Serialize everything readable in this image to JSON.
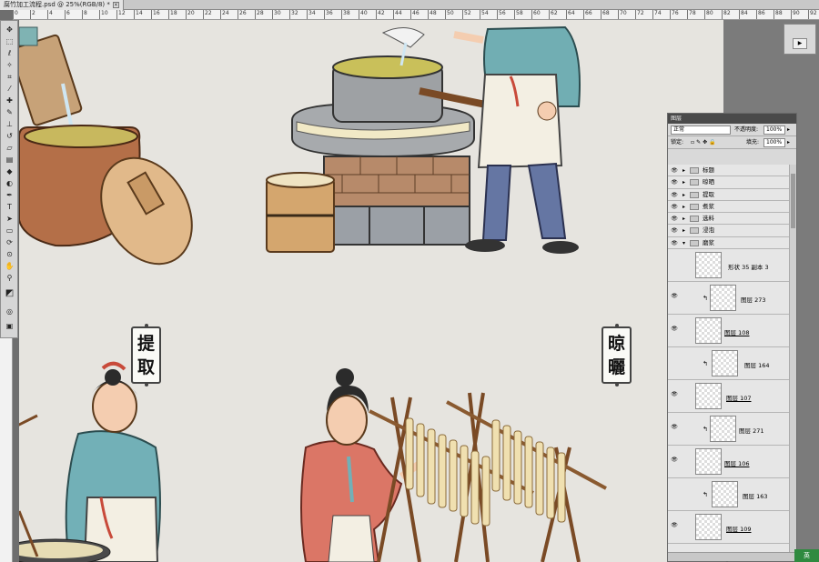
{
  "document": {
    "tab_title": "腐竹加工流程.psd @ 25%(RGB/8) *",
    "ruler_labels": [
      "0",
      "2",
      "4",
      "6",
      "8",
      "10",
      "12",
      "14",
      "16",
      "18",
      "20",
      "22",
      "24",
      "26",
      "28",
      "30",
      "32",
      "34",
      "36",
      "38",
      "40",
      "42",
      "44",
      "46",
      "48",
      "50",
      "52",
      "54",
      "56",
      "58",
      "60",
      "62",
      "64",
      "66",
      "68",
      "70",
      "72",
      "74",
      "76",
      "78",
      "80",
      "82",
      "84",
      "86",
      "88",
      "90",
      "92",
      "94"
    ]
  },
  "canvas": {
    "sign_extract": "提\n取",
    "sign_dry": "晾\n曬"
  },
  "layers_panel": {
    "title": "图层",
    "blend_mode": "正常",
    "opacity_label": "不透明度:",
    "opacity_value": "100%",
    "lock_label": "锁定:",
    "fill_label": "填充:",
    "fill_value": "100%",
    "groups": [
      {
        "name": "标题",
        "expanded": false
      },
      {
        "name": "晾晒",
        "expanded": false
      },
      {
        "name": "提取",
        "expanded": false
      },
      {
        "name": "煮浆",
        "expanded": false
      },
      {
        "name": "选料",
        "expanded": false
      },
      {
        "name": "浸泡",
        "expanded": false
      },
      {
        "name": "磨浆",
        "expanded": true
      }
    ],
    "layers": [
      {
        "name": "形状 35 副本 3",
        "clipped": false
      },
      {
        "name": "图层 273",
        "clipped": true
      },
      {
        "name": "图层 108",
        "clipped": false
      },
      {
        "name": "图层 164",
        "clipped": true
      },
      {
        "name": "图层 107",
        "clipped": false
      },
      {
        "name": "图层 271",
        "clipped": true
      },
      {
        "name": "图层 106",
        "clipped": false
      },
      {
        "name": "图层 163",
        "clipped": true
      },
      {
        "name": "图层 109",
        "clipped": false
      }
    ]
  },
  "taskbar": {
    "ime_label": "英"
  },
  "icons": [
    "move-icon",
    "marquee-icon",
    "lasso-icon",
    "crop-icon",
    "eyedropper-icon",
    "brush-icon",
    "clone-stamp-icon",
    "eraser-icon",
    "gradient-icon",
    "dodge-icon",
    "pen-icon",
    "type-icon",
    "path-select-icon",
    "shape-icon",
    "hand-icon",
    "zoom-icon",
    "eye-icon",
    "folder-icon",
    "link-icon"
  ]
}
